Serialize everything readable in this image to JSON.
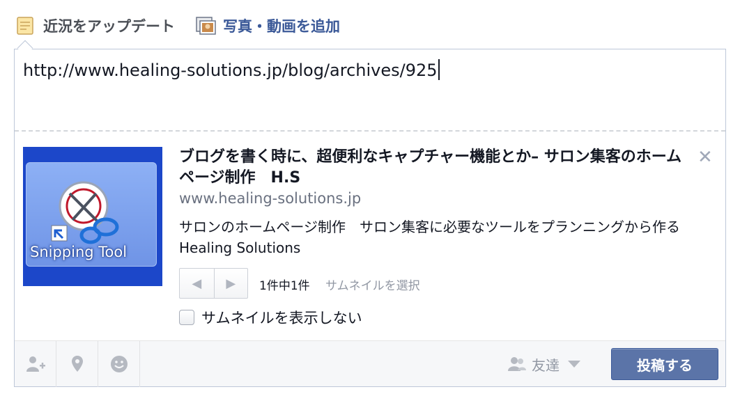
{
  "tabs": {
    "status_label": "近況をアップデート",
    "photo_label": "写真・動画を追加"
  },
  "composer": {
    "input_value": "http://www.healing-solutions.jp/blog/archives/925"
  },
  "preview": {
    "thumbnail_text": "Snipping Tool",
    "title": "ブログを書く時に、超便利なキャプチャー機能とか– サロン集客のホームページ制作　H.S",
    "domain": "www.healing-solutions.jp",
    "description": "サロンのホームページ制作　サロン集客に必要なツールをプランニングから作る　Healing Solutions",
    "close_symbol": "✕",
    "pager_prev": "◀",
    "pager_next": "▶",
    "pager_count": "1件中1件",
    "choose_thumbnail": "サムネイルを選択",
    "no_thumbnail_label": "サムネイルを表示しない"
  },
  "footer": {
    "icons": [
      "tag-friends-icon",
      "location-pin-icon",
      "feeling-smiley-icon"
    ],
    "audience_label": "友達",
    "post_label": "投稿する"
  },
  "colors": {
    "brand_blue": "#3b5998",
    "post_button": "#5b74a8",
    "border": "#bdc7d8",
    "muted_text": "#9197a3"
  }
}
